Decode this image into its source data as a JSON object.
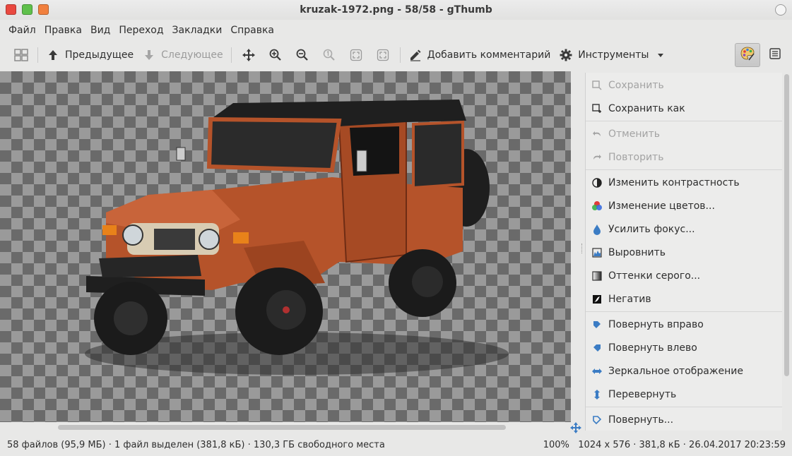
{
  "window": {
    "title": "kruzak-1972.png - 58/58 - gThumb"
  },
  "menubar": [
    "Файл",
    "Правка",
    "Вид",
    "Переход",
    "Закладки",
    "Справка"
  ],
  "toolbar": {
    "prev_label": "Предыдущее",
    "next_label": "Следующее",
    "comment_label": "Добавить комментарий",
    "tools_label": "Инструменты"
  },
  "tools_panel": {
    "save": "Сохранить",
    "save_as": "Сохранить как",
    "undo": "Отменить",
    "redo": "Повторить",
    "contrast": "Изменить контрастность",
    "colors": "Изменение цветов...",
    "sharpen": "Усилить фокус...",
    "equalize": "Выровнить",
    "grayscale": "Оттенки серого...",
    "negative": "Негатив",
    "rotate_right": "Повернуть вправо",
    "rotate_left": "Повернуть влево",
    "mirror": "Зеркальное отображение",
    "flip": "Перевернуть",
    "rotate": "Повернуть..."
  },
  "status": {
    "left": "58 файлов (95,9 МБ) · 1 файл выделен (381,8 кБ) · 130,3 ГБ свободного места",
    "zoom": "100%",
    "info": "1024 x 576 · 381,8 кБ · 26.04.2017 20:23:59"
  },
  "colors": {
    "accent": "#3b7cc4",
    "vehicle_body": "#b5532a",
    "close_btn": "#e9483f",
    "max_btn": "#5fc04b",
    "min_btn": "#f1803e"
  }
}
